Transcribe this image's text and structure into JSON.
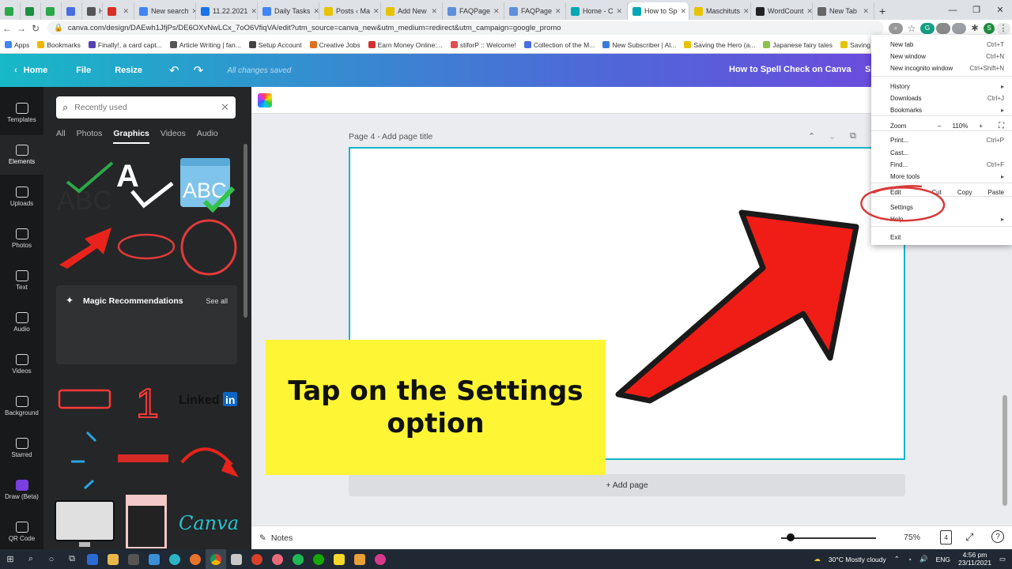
{
  "browser": {
    "tabs": [
      {
        "label": "",
        "color": "#2aa84a"
      },
      {
        "label": "",
        "color": "#1e8e3e"
      },
      {
        "label": "",
        "color": "#2aa84a"
      },
      {
        "label": "",
        "color": "#4a6ee0"
      },
      {
        "label": "H",
        "color": "#555555"
      },
      {
        "label": "",
        "color": "#d93025"
      },
      {
        "label": "New search",
        "color": "#4285f4"
      },
      {
        "label": "11.22.2021",
        "color": "#1a73e8"
      },
      {
        "label": "Daily Tasks",
        "color": "#4285f4"
      },
      {
        "label": "Posts ‹ Ma",
        "color": "#e6c300"
      },
      {
        "label": "Add New",
        "color": "#e6c300"
      },
      {
        "label": "FAQPage",
        "color": "#5f8fd8"
      },
      {
        "label": "FAQPage",
        "color": "#5f8fd8"
      },
      {
        "label": "Home - C",
        "color": "#00a9b5"
      },
      {
        "label": "How to Sp",
        "color": "#00a9b5",
        "active": true
      },
      {
        "label": "Maschituts",
        "color": "#e6c300"
      },
      {
        "label": "WordCount",
        "color": "#222222"
      },
      {
        "label": "New Tab",
        "color": "#666666"
      }
    ],
    "new_tab_symbol": "+",
    "window_controls": [
      "—",
      "❐",
      "✕"
    ],
    "url": "canva.com/design/DAEwh1JfjPs/DE6OXvNwLCx_7oO6VfiqVA/edit?utm_source=canva_new&utm_medium=redirect&utm_campaign=google_promo",
    "bookmarks": [
      "Apps",
      "Bookmarks",
      "Finally!, a card capt...",
      "Article Writing | fan...",
      "Setup Account",
      "Creative Jobs",
      "Earn Money Online:...",
      "stiforP :: Welcome!",
      "Collection of the M...",
      "New Subscriber | Al...",
      "Saving the Hero (a...",
      "Japanese fairy tales",
      "Saving"
    ],
    "profile_initial": "S"
  },
  "canva": {
    "home_label": "Home",
    "file_label": "File",
    "resize_label": "Resize",
    "saved_status": "All changes saved",
    "doc_title": "How to Spell Check on Canva",
    "share_initial": "S",
    "rail": [
      {
        "label": "Templates"
      },
      {
        "label": "Elements",
        "active": true
      },
      {
        "label": "Uploads"
      },
      {
        "label": "Photos"
      },
      {
        "label": "Text"
      },
      {
        "label": "Audio"
      },
      {
        "label": "Videos"
      },
      {
        "label": "Background"
      },
      {
        "label": "Starred"
      },
      {
        "label": "Draw (Beta)"
      },
      {
        "label": "QR Code"
      }
    ],
    "search_placeholder": "Recently used",
    "panel_tabs": [
      "All",
      "Photos",
      "Graphics",
      "Videos",
      "Audio"
    ],
    "active_panel_tab": "Graphics",
    "magic_title": "Magic Recommendations",
    "see_all": "See all",
    "graphics": {
      "abc_text": "ABC",
      "big_a": "A",
      "number_one": "1",
      "linkedin_text": "Linked",
      "linkedin_in": "in",
      "canva_logo": "Canva"
    },
    "page_label_prefix": "Page 4 - ",
    "page_label_title": "Add page title",
    "add_page": "+ Add page",
    "notes_label": "Notes",
    "zoom": "75%",
    "zoom_fraction": 0.1,
    "page_count": "4",
    "help_symbol": "?"
  },
  "callout_text": "Tap on the Settings option",
  "chrome_menu": {
    "items": [
      {
        "label": "New tab",
        "shortcut": "Ctrl+T"
      },
      {
        "label": "New window",
        "shortcut": "Ctrl+N"
      },
      {
        "label": "New incognito window",
        "shortcut": "Ctrl+Shift+N"
      },
      {
        "label": "History",
        "shortcut": "▸"
      },
      {
        "label": "Downloads",
        "shortcut": "Ctrl+J"
      },
      {
        "label": "Bookmarks",
        "shortcut": "▸"
      },
      {
        "label": "Zoom",
        "shortcut": ""
      },
      {
        "label": "Print...",
        "shortcut": "Ctrl+P"
      },
      {
        "label": "Cast...",
        "shortcut": ""
      },
      {
        "label": "Find...",
        "shortcut": "Ctrl+F"
      },
      {
        "label": "More tools",
        "shortcut": "▸"
      },
      {
        "label": "Edit",
        "shortcut": ""
      },
      {
        "label": "Settings",
        "shortcut": ""
      },
      {
        "label": "Help",
        "shortcut": "▸"
      },
      {
        "label": "Exit",
        "shortcut": ""
      }
    ],
    "zoom_minus": "–",
    "zoom_value": "110%",
    "zoom_plus": "+",
    "edit_cut": "Cut",
    "edit_copy": "Copy",
    "edit_paste": "Paste"
  },
  "taskbar": {
    "weather": "30°C  Mostly cloudy",
    "language": "ENG",
    "time": "4:56 pm",
    "date": "23/11/2021"
  },
  "colors": {
    "canva_teal": "#13b6c7",
    "callout_yellow": "#fef534",
    "arrow_red": "#f01d16",
    "circle_red": "#d93838"
  }
}
